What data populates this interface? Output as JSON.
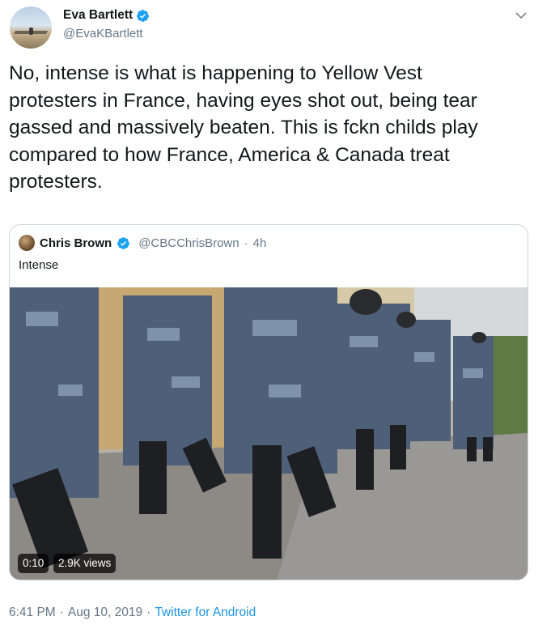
{
  "author": {
    "name": "Eva Bartlett",
    "handle": "@EvaKBartlett",
    "verified": true
  },
  "tweet": {
    "text": "No, intense is what is happening to Yellow Vest\nprotesters in France, having eyes shot out, being tear\ngassed and massively beaten. This is fckn childs play\ncompared to how France, America & Canada treat\nprotesters."
  },
  "quoted_tweet": {
    "author_name": "Chris Brown",
    "author_handle": "@CBCChrisBrown",
    "separator": "·",
    "age": "4h",
    "text": "Intense",
    "video": {
      "duration": "0:10",
      "views": "2.9K views"
    }
  },
  "footer": {
    "time": "6:41 PM",
    "separator": "·",
    "date": "Aug 10, 2019",
    "separator2": "·",
    "app": "Twitter for Android"
  },
  "colors": {
    "accent": "#1da1f2",
    "text": "#14171a",
    "muted": "#657786",
    "link": "#1b95e0",
    "border": "#ccd6dd"
  },
  "icons": {
    "verified": "verified-badge-icon",
    "caret": "chevron-down-icon"
  }
}
